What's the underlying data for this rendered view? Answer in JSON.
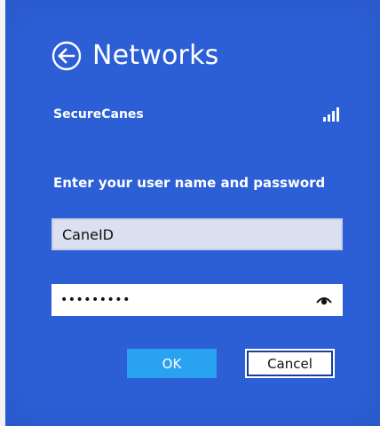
{
  "header": {
    "title": "Networks",
    "back_icon": "back-arrow-circle-icon"
  },
  "network": {
    "name": "SecureCanes",
    "signal_icon": "signal-strength-icon",
    "signal_level": "4 of 4 bars"
  },
  "form": {
    "prompt": "Enter your user name and password",
    "username_value": "CaneID",
    "password_value": "•••••••••",
    "reveal_icon": "eye-icon"
  },
  "buttons": {
    "ok_label": "OK",
    "cancel_label": "Cancel"
  },
  "colors": {
    "panel_background": "#2c5fd6",
    "ok_button": "#29a3f0",
    "username_field": "#dae0ef"
  }
}
